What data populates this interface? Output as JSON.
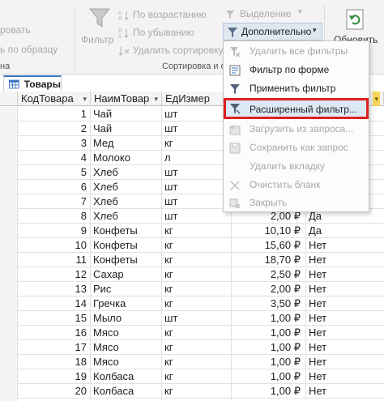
{
  "ribbon": {
    "clipboard": {
      "refresh_partial": "ровать",
      "format_painter_partial": "ь по образцу",
      "group_label_partial": "на"
    },
    "sort_filter": {
      "filter_label": "Фильтр",
      "sort_asc": "По возрастанию",
      "sort_desc": "По убыванию",
      "remove_sort": "Удалить сортировку",
      "selection": "Выделение",
      "advanced": "Дополнительно",
      "group_label_partial": "Сортировка и фи"
    },
    "records": {
      "refresh_label_partial": "Обновить"
    }
  },
  "tab": {
    "label": "Товары"
  },
  "grid": {
    "columns": [
      {
        "label": "КодТовара"
      },
      {
        "label": "НаимТовар"
      },
      {
        "label": "ЕдИзмер"
      },
      {
        "label": ""
      },
      {
        "label": ""
      }
    ],
    "rows": [
      {
        "id": "1",
        "name": "Чай",
        "unit": "шт",
        "price": "",
        "flag": ""
      },
      {
        "id": "2",
        "name": "Чай",
        "unit": "шт",
        "price": "",
        "flag": ""
      },
      {
        "id": "3",
        "name": "Мед",
        "unit": "кг",
        "price": "",
        "flag": ""
      },
      {
        "id": "4",
        "name": "Молоко",
        "unit": "л",
        "price": "",
        "flag": ""
      },
      {
        "id": "5",
        "name": "Хлеб",
        "unit": "шт",
        "price": "",
        "flag": ""
      },
      {
        "id": "6",
        "name": "Хлеб",
        "unit": "шт",
        "price": "",
        "flag": ""
      },
      {
        "id": "7",
        "name": "Хлеб",
        "unit": "шт",
        "price": "",
        "flag": ""
      },
      {
        "id": "8",
        "name": "Хлеб",
        "unit": "шт",
        "price": "2,00 ₽",
        "flag": "Да"
      },
      {
        "id": "9",
        "name": "Конфеты",
        "unit": "кг",
        "price": "10,10 ₽",
        "flag": "Да"
      },
      {
        "id": "10",
        "name": "Конфеты",
        "unit": "кг",
        "price": "15,60 ₽",
        "flag": "Нет"
      },
      {
        "id": "11",
        "name": "Конфеты",
        "unit": "кг",
        "price": "18,70 ₽",
        "flag": "Нет"
      },
      {
        "id": "12",
        "name": "Сахар",
        "unit": "кг",
        "price": "2,50 ₽",
        "flag": "Нет"
      },
      {
        "id": "13",
        "name": "Рис",
        "unit": "кг",
        "price": "2,00 ₽",
        "flag": "Нет"
      },
      {
        "id": "14",
        "name": "Гречка",
        "unit": "кг",
        "price": "3,50 ₽",
        "flag": "Нет"
      },
      {
        "id": "15",
        "name": "Мыло",
        "unit": "шт",
        "price": "1,00 ₽",
        "flag": "Нет"
      },
      {
        "id": "16",
        "name": "Мясо",
        "unit": "кг",
        "price": "1,00 ₽",
        "flag": "Нет"
      },
      {
        "id": "17",
        "name": "Мясо",
        "unit": "кг",
        "price": "1,00 ₽",
        "flag": "Нет"
      },
      {
        "id": "18",
        "name": "Мясо",
        "unit": "кг",
        "price": "1,00 ₽",
        "flag": "Нет"
      },
      {
        "id": "19",
        "name": "Колбаса",
        "unit": "кг",
        "price": "1,00 ₽",
        "flag": "Нет"
      },
      {
        "id": "20",
        "name": "Колбаса",
        "unit": "кг",
        "price": "1,00 ₽",
        "flag": "Нет"
      },
      {
        "id": "",
        "name": "",
        "unit": "",
        "price": "",
        "flag": ""
      }
    ]
  },
  "menu": {
    "items": [
      {
        "label": "Удалить все фильтры",
        "enabled": false,
        "icon": "clear-filters-icon"
      },
      {
        "label": "Фильтр по форме",
        "enabled": true,
        "icon": "filter-by-form-icon"
      },
      {
        "label": "Применить фильтр",
        "enabled": true,
        "icon": "apply-filter-icon"
      },
      {
        "label": "Расширенный фильтр...",
        "enabled": true,
        "icon": "advanced-filter-icon"
      },
      {
        "label": "Загрузить из запроса...",
        "enabled": false,
        "icon": "load-from-query-icon"
      },
      {
        "label": "Сохранить как запрос",
        "enabled": false,
        "icon": "save-as-query-icon"
      },
      {
        "label": "Удалить вкладку",
        "enabled": false,
        "icon": "delete-tab-icon"
      },
      {
        "label": "Очистить бланк",
        "enabled": false,
        "icon": "clear-grid-icon"
      },
      {
        "label": "Закрыть",
        "enabled": false,
        "icon": "close-icon"
      }
    ]
  },
  "colors": {
    "highlight_border": "#e02020",
    "tab_accent": "#3a73c0"
  }
}
